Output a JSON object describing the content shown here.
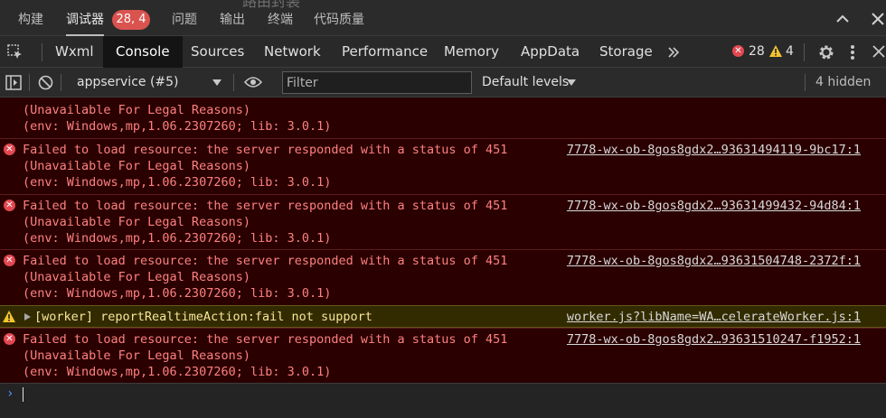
{
  "top_tabs": [
    {
      "label": "构建"
    },
    {
      "label": "调试器"
    },
    {
      "label": "问题"
    },
    {
      "label": "输出"
    },
    {
      "label": "终端"
    },
    {
      "label": "代码质量"
    }
  ],
  "debugger_badge": "28, 4",
  "ghost_text": "路由封装",
  "devtools_tabs": [
    {
      "label": "Wxml"
    },
    {
      "label": "Console"
    },
    {
      "label": "Sources"
    },
    {
      "label": "Network"
    },
    {
      "label": "Performance"
    },
    {
      "label": "Memory"
    },
    {
      "label": "AppData"
    },
    {
      "label": "Storage"
    }
  ],
  "more_tabs_icon": "double-chevron-right-icon",
  "counts": {
    "errors": "28",
    "warnings": "4"
  },
  "toolbar": {
    "context": "appservice (#5)",
    "filter_placeholder": "Filter",
    "levels": "Default levels",
    "hidden": "4 hidden"
  },
  "messages": [
    {
      "type": "error",
      "lines": [
        "Failed to load resource: the server responded with a status of 451",
        "(Unavailable For Legal Reasons)",
        "(env: Windows,mp,1.06.2307260; lib: 3.0.1)"
      ],
      "source": "7778-wx-ob-8gos8gdx2…93631494119-9bc17:1"
    },
    {
      "type": "error",
      "lines": [
        "Failed to load resource: the server responded with a status of 451",
        "(Unavailable For Legal Reasons)",
        "(env: Windows,mp,1.06.2307260; lib: 3.0.1)"
      ],
      "source": "7778-wx-ob-8gos8gdx2…93631499432-94d84:1"
    },
    {
      "type": "error",
      "lines": [
        "Failed to load resource: the server responded with a status of 451",
        "(Unavailable For Legal Reasons)",
        "(env: Windows,mp,1.06.2307260; lib: 3.0.1)"
      ],
      "source": "7778-wx-ob-8gos8gdx2…93631504748-2372f:1"
    },
    {
      "type": "warn",
      "lines": [
        "[worker] reportRealtimeAction:fail not support"
      ],
      "source": "worker.js?libName=WA…celerateWorker.js:1"
    },
    {
      "type": "error",
      "lines": [
        "Failed to load resource: the server responded with a status of 451",
        "(Unavailable For Legal Reasons)",
        "(env: Windows,mp,1.06.2307260; lib: 3.0.1)"
      ],
      "source": "7778-wx-ob-8gos8gdx2…93631510247-f1952:1"
    }
  ],
  "partial_message": {
    "lines": [
      "(Unavailable For Legal Reasons)",
      "(env: Windows,mp,1.06.2307260; lib: 3.0.1)"
    ]
  },
  "colors": {
    "error_bg": "#2a0000",
    "error_text": "#ff8080",
    "warn_bg": "#332b00",
    "warn_text": "#f7e59b",
    "badge": "#d9534f"
  }
}
